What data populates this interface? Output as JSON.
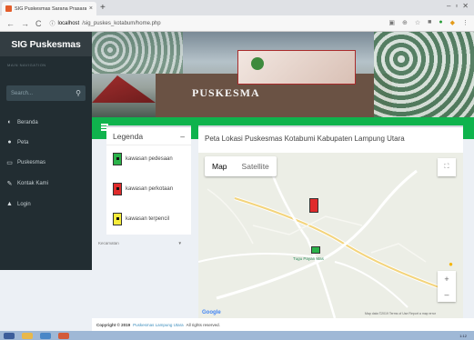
{
  "browser": {
    "tab_title": "SIG Puskesmas Sarana Prasaran",
    "new_tab": "+",
    "url_host": "localhost",
    "url_path": "/sig_puskes_kotabum/home.php",
    "nav_back": "←",
    "nav_forward": "→",
    "nav_reload": "C",
    "window_controls": [
      "–",
      "▫",
      "✕"
    ]
  },
  "sidebar": {
    "brand": "SIG Puskesmas",
    "section_label": "MAIN NAVIGATION",
    "search_placeholder": "Search...",
    "items": [
      {
        "label": "Beranda",
        "icon": "dashboard-icon",
        "glyph": "◐"
      },
      {
        "label": "Peta",
        "icon": "globe-icon",
        "glyph": "●"
      },
      {
        "label": "Puskesmas",
        "icon": "building-icon",
        "glyph": "▭"
      },
      {
        "label": "Kontak Kami",
        "icon": "edit-icon",
        "glyph": "✎"
      },
      {
        "label": "Login",
        "icon": "user-icon",
        "glyph": "▲"
      }
    ]
  },
  "header": {
    "banner_word": "PUSKESMA"
  },
  "legend": {
    "title": "Legenda",
    "collapse": "–",
    "items": [
      {
        "label": "kawasan pedesaan",
        "color": "#2bb34a",
        "color_name": "green"
      },
      {
        "label": "kawasan perkotaan",
        "color": "#e02b2b",
        "color_name": "red"
      },
      {
        "label": "kawasan terpencil",
        "color": "#f5ec3a",
        "color_name": "yellow"
      }
    ]
  },
  "filter": {
    "label": "Kecamatan",
    "arrow": "▼"
  },
  "map": {
    "title": "Peta Lokasi Puskesmas Kotabumi Kabupaten Lampung Utara",
    "type_map": "Map",
    "type_satellite": "Satellite",
    "fullscreen": "⛶",
    "zoom_in": "+",
    "zoom_out": "–",
    "google": "Google",
    "attribution": "Map data ©2019   Terms of Use   Report a map error",
    "place_label": "Tugu Payan Mas"
  },
  "footer": {
    "prefix": "Copyright © 2019",
    "org": "Puskesmas Lampung Utara",
    "suffix": "All rights reserved."
  },
  "taskbar": {
    "clock": "1:12"
  },
  "colors": {
    "sidebar_bg": "#222d32",
    "brand_bg": "#333d42",
    "topnav_green": "#0fb34d",
    "content_bg": "#ecf0f5"
  }
}
